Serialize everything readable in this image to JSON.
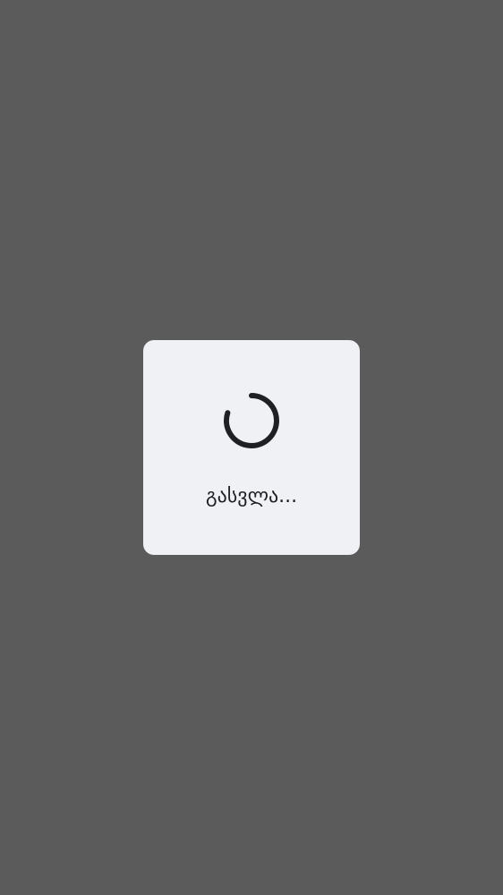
{
  "dialog": {
    "message": "გასვლა..."
  },
  "icons": {
    "spinner": "loading-spinner-icon"
  },
  "colors": {
    "backdrop": "#5b5b5b",
    "dialog_background": "#f0f1f5",
    "text": "#1f2024",
    "spinner": "#1f2024"
  }
}
